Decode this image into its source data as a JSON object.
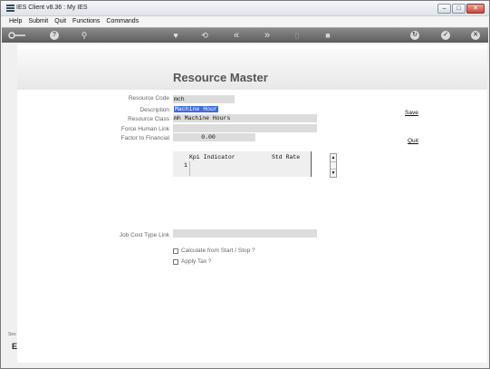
{
  "window": {
    "title": "IES Client v8.36 : My IES"
  },
  "menu": [
    "Help",
    "Submit",
    "Quit",
    "Functions",
    "Commands"
  ],
  "toolbar": {
    "icons": [
      "key-icon",
      "help-icon",
      "search-icon",
      "heart-icon",
      "back-icon",
      "rewind-icon",
      "forward-icon",
      "bookmark-icon",
      "stop-icon",
      "refresh-icon",
      "check-icon",
      "close-icon"
    ],
    "help_glyph": "?",
    "search_glyph": "⚲",
    "heart_glyph": "♥",
    "back_glyph": "⟲",
    "rewind_glyph": "«",
    "forward_glyph": "»",
    "bookmark_glyph": "▯",
    "stop_glyph": "■",
    "refresh_glyph": "↻",
    "check_glyph": "✓",
    "close_glyph": "✕"
  },
  "page": {
    "title": "Resource Master"
  },
  "form": {
    "resource_code": {
      "label": "Resource Code",
      "value": "mch"
    },
    "description": {
      "label": "Description",
      "value": "Machine Hour"
    },
    "resource_class": {
      "label": "Resource Class",
      "value": "mh Machine Hours"
    },
    "force_human_link": {
      "label": "Force Human Link",
      "value": ""
    },
    "factor_to_financial": {
      "label": "Factor to Financial",
      "value": "0.00"
    },
    "job_cost_type_link": {
      "label": "Job Cost Type Link",
      "value": ""
    },
    "calculate_from_start_stop": {
      "label": "Calculate from Start / Stop ?",
      "checked": false
    },
    "apply_tax": {
      "label": "Apply Tax ?",
      "checked": false
    }
  },
  "grid": {
    "columns": [
      "Kpi Indicator",
      "Std Rate"
    ],
    "rows": [
      {
        "index": "1"
      }
    ]
  },
  "actions": {
    "save": "Save",
    "quit": "Quit"
  },
  "side": {
    "label": "Ses",
    "glyph": "E"
  }
}
